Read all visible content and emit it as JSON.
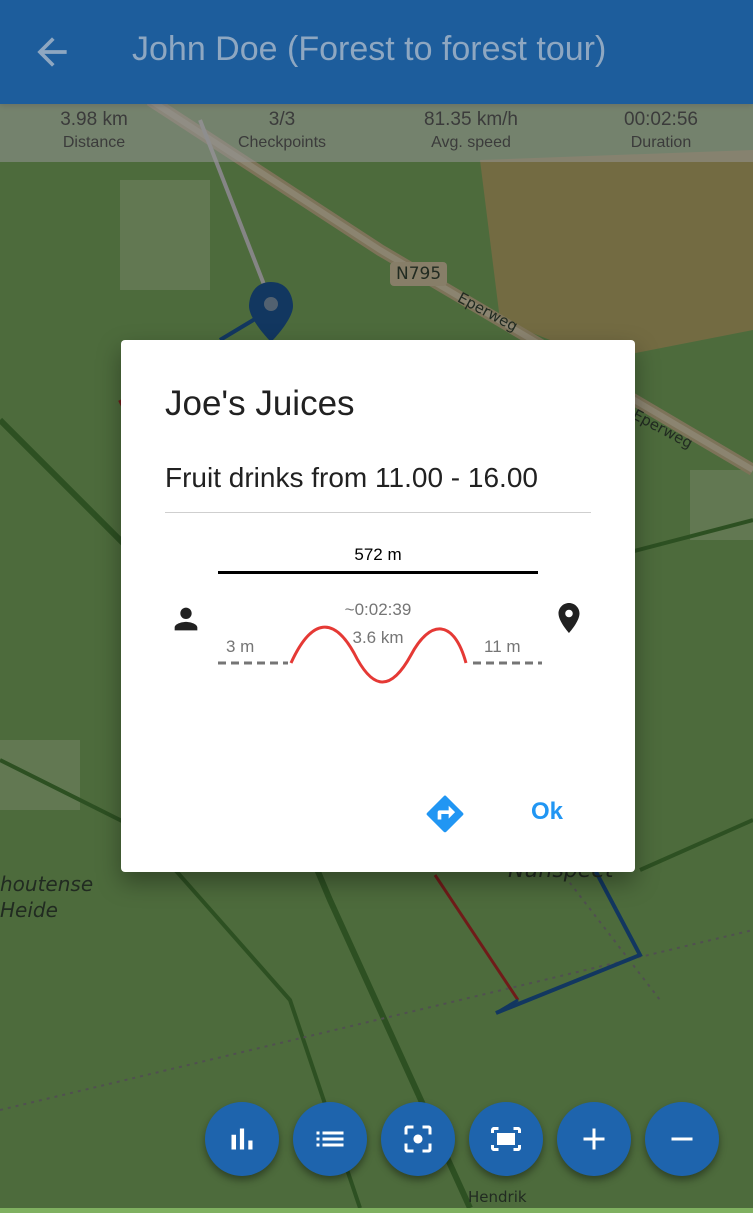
{
  "app_bar": {
    "back_icon": "arrow-back-icon",
    "title": "John Doe (Forest to forest tour)"
  },
  "stats": [
    {
      "value": "3.98 km",
      "label": "Distance"
    },
    {
      "value": "3/3",
      "label": "Checkpoints"
    },
    {
      "value": "81.35 km/h",
      "label": "Avg. speed"
    },
    {
      "value": "00:02:56",
      "label": "Duration"
    }
  ],
  "map": {
    "road_label": "N795",
    "street_label_1": "Eperweg",
    "street_label_2": "Eperweg",
    "area_label_1": "houtense",
    "area_label_2": "Heide",
    "place_label": "Nunspeet",
    "bottom_label": "Hendrik",
    "colors": {
      "forest": "#7fb060",
      "route_blue": "#1f5fa5",
      "route_red": "#c0302b"
    }
  },
  "dialog": {
    "title": "Joe's Juices",
    "description": "Fruit drinks from 11.00 - 16.00",
    "distance_total": "572 m",
    "estimated_duration": "~0:02:39",
    "route_distance": "3.6 km",
    "start_offset": "3 m",
    "end_offset": "11 m",
    "person_icon": "person-icon",
    "pin_icon": "map-pin-icon",
    "navigate_icon": "directions-icon",
    "ok_label": "Ok",
    "colors": {
      "accent": "#2196f3",
      "route": "#e53935"
    }
  },
  "fab_buttons": [
    {
      "icon": "bar-chart-icon"
    },
    {
      "icon": "list-icon"
    },
    {
      "icon": "focus-icon"
    },
    {
      "icon": "fit-screen-icon"
    },
    {
      "icon": "zoom-in-icon"
    },
    {
      "icon": "zoom-out-icon"
    }
  ]
}
